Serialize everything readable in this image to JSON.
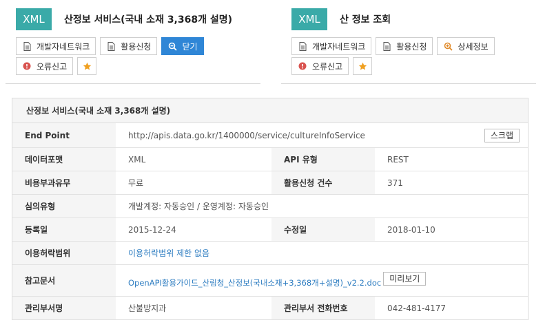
{
  "left_card": {
    "badge": "XML",
    "title": "산정보 서비스(국내 소재 3,368개 설명)",
    "buttons": {
      "dev_network": "개발자네트워크",
      "apply": "활용신청",
      "close": "닫기",
      "report": "오류신고"
    }
  },
  "right_card": {
    "badge": "XML",
    "title": "산 정보 조회",
    "buttons": {
      "dev_network": "개발자네트워크",
      "apply": "활용신청",
      "detail": "상세정보",
      "report": "오류신고"
    }
  },
  "detail": {
    "title": "산정보 서비스(국내 소재 3,368개 설명)",
    "endpoint_label": "End Point",
    "endpoint_value": "http://apis.data.go.kr/1400000/service/cultureInfoService",
    "scrap_label": "스크랩",
    "format_label": "데이터포맷",
    "format_value": "XML",
    "api_type_label": "API 유형",
    "api_type_value": "REST",
    "cost_label": "비용부과유무",
    "cost_value": "무료",
    "apply_count_label": "활용신청 건수",
    "apply_count_value": "371",
    "review_label": "심의유형",
    "review_value": "개발계정: 자동승인 / 운영계정: 자동승인",
    "reg_date_label": "등록일",
    "reg_date_value": "2015-12-24",
    "mod_date_label": "수정일",
    "mod_date_value": "2018-01-10",
    "license_label": "이용허락범위",
    "license_value": "이용허락범위 제한 없음",
    "ref_label": "참고문서",
    "ref_value": "OpenAPI활용가이드_산림청_산정보(국내소재+3,368개+설명)_v2.2.doc",
    "preview_label": "미리보기",
    "dept_label": "관리부서명",
    "dept_value": "산불방지과",
    "phone_label": "관리부서 전화번호",
    "phone_value": "042-481-4177"
  },
  "colors": {
    "badge": "#3aaaa8",
    "primary_button": "#2f86d6",
    "report_icon": "#d9534f",
    "star": "#f0a020",
    "link": "#2e7dc1"
  }
}
